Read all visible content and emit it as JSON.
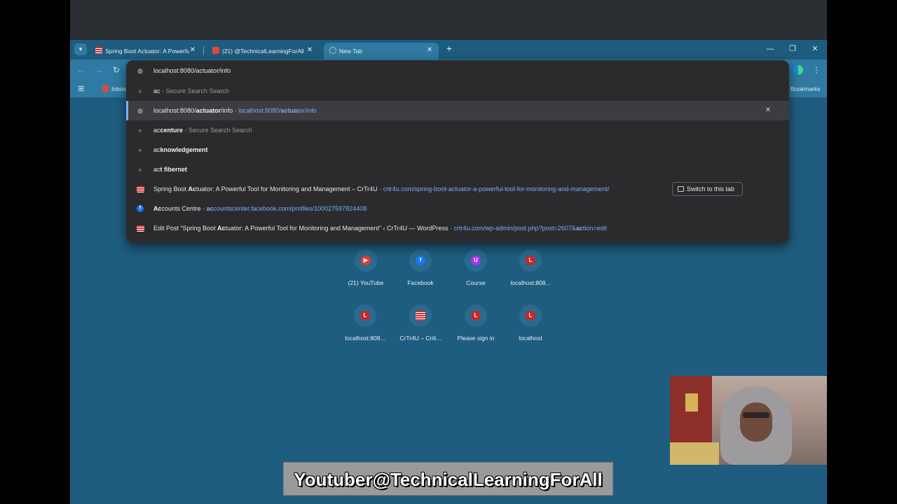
{
  "tabs": [
    {
      "title": "Spring Boot Actuator: A Powerfu",
      "favicon": "crtr4u-favicon",
      "active": false
    },
    {
      "title": "(21) @TechnicalLearningForAll",
      "favicon": "youtube-favicon",
      "active": false
    },
    {
      "title": "New Tab",
      "favicon": "new-tab-favicon",
      "active": true
    }
  ],
  "bookmarks_bar": {
    "items": [
      {
        "label": "Inbox"
      }
    ],
    "right_label": "Bookmarks"
  },
  "omnibox": {
    "input_value": "localhost:8080/actuator/info",
    "suggestions": [
      {
        "type": "search",
        "icon": "search-icon",
        "parts": [
          "ac",
          " - ",
          "Secure Search Search"
        ]
      },
      {
        "type": "url",
        "icon": "globe-icon",
        "parts": [
          "localhost:8080/",
          "actuator",
          "/info",
          " - ",
          "localhost:8080/",
          "actua",
          "tor/info"
        ],
        "selected": true
      },
      {
        "type": "search",
        "icon": "search-icon",
        "parts": [
          "ac",
          "centure",
          " - ",
          "Secure Search Search"
        ]
      },
      {
        "type": "search",
        "icon": "search-icon",
        "parts": [
          "ac",
          "knowledgement"
        ]
      },
      {
        "type": "search",
        "icon": "search-icon",
        "parts": [
          "ac",
          "t fibernet"
        ]
      },
      {
        "type": "history",
        "icon": "crtr4u-favicon",
        "parts": [
          "Spring Boot ",
          "Ac",
          "tuator: A Powerful Tool for Monitoring and Management – CrTr4U",
          " - ",
          "crtr4u.com/spring-boot-actuator-a-powerful-tool-for-monitoring-and-management/"
        ],
        "action": "Switch to this tab"
      },
      {
        "type": "history",
        "icon": "facebook-favicon",
        "parts": [
          "Ac",
          "counts Centre",
          " - ",
          "ac",
          "countscenter.facebook.com/profiles/100027597824408"
        ]
      },
      {
        "type": "history",
        "icon": "crtr4u-favicon",
        "parts": [
          "Edit Post “Spring Boot ",
          "Ac",
          "tuator: A Powerful Tool for Monitoring and Management” ‹ CrTr4U — WordPress",
          " - ",
          "crtr4u.com/wp-admin/post.php?post=2607&",
          "ac",
          "tion=edit"
        ]
      }
    ]
  },
  "shortcuts": [
    {
      "label": "(21) YouTube",
      "icon": "youtube-icon",
      "letter": "▶",
      "color": "#e53935"
    },
    {
      "label": "Facebook",
      "icon": "facebook-icon",
      "letter": "f",
      "color": "#1877f2"
    },
    {
      "label": "Course",
      "icon": "course-icon",
      "letter": "U",
      "color": "#a435f0"
    },
    {
      "label": "localhost:808...",
      "icon": "letter-l-icon",
      "letter": "L",
      "color": "#c62828"
    },
    {
      "label": "localhost:808...",
      "icon": "letter-l-icon",
      "letter": "L",
      "color": "#c62828"
    },
    {
      "label": "CrTr4U – Criti...",
      "icon": "crtr4u-icon",
      "letter": "",
      "color": "#b71c1c"
    },
    {
      "label": "Please sign in",
      "icon": "letter-l-icon",
      "letter": "L",
      "color": "#c62828"
    },
    {
      "label": "localhost",
      "icon": "letter-l-icon",
      "letter": "L",
      "color": "#c62828"
    }
  ],
  "caption": "Youtuber@TechnicalLearningForAll"
}
